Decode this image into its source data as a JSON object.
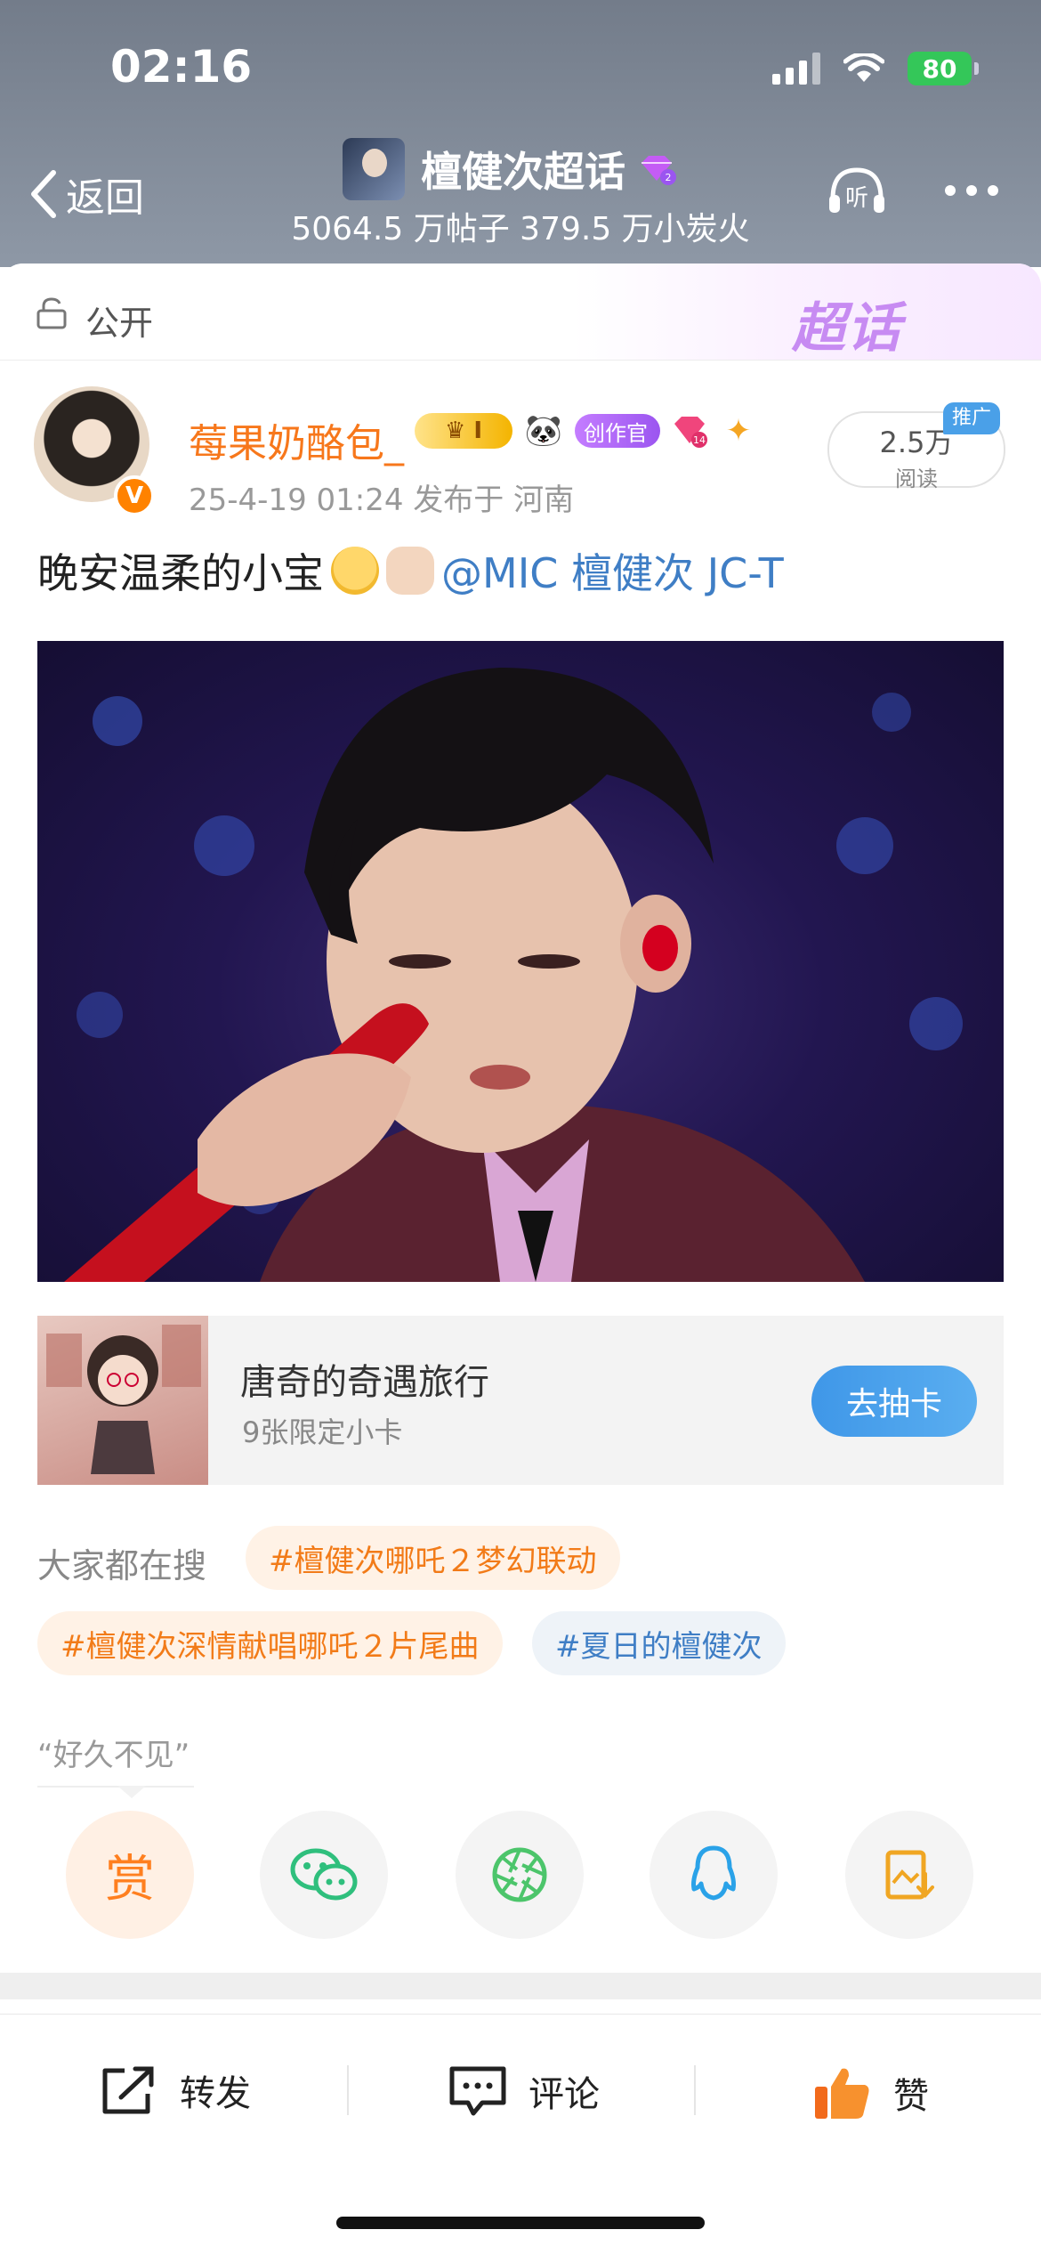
{
  "status_bar": {
    "time": "02:16",
    "battery": "80"
  },
  "header": {
    "back_label": "返回",
    "topic_title": "檀健次超话",
    "topic_stats": "5064.5 万帖子  379.5 万小炭火",
    "listen_icon_text": "听"
  },
  "visibility": {
    "label": "公开",
    "logo_text": "超话"
  },
  "post": {
    "username": "莓果奶酪包_",
    "crown_level": "I",
    "creator_badge": "创作官",
    "gem_level": "14",
    "meta": "25-4-19 01:24  发布于 河南",
    "read_count": "2.5万",
    "read_label": "阅读",
    "promo_tag": "推广",
    "text": "晚安温柔的小宝",
    "mention": "@MIC 檀健次 JC-T"
  },
  "promo_card": {
    "title": "唐奇的奇遇旅行",
    "subtitle": "9张限定小卡",
    "button": "去抽卡"
  },
  "search": {
    "label": "大家都在搜",
    "tags": [
      "#檀健次哪吒２梦幻联动",
      "#檀健次深情献唱哪吒２片尾曲",
      "#夏日的檀健次"
    ]
  },
  "quote": "“好久不见”",
  "share": {
    "reward_label": "赏"
  },
  "actions": {
    "repost": "转发",
    "comment": "评论",
    "like": "赞"
  },
  "colors": {
    "accent_orange": "#f7771b",
    "link_blue": "#3f7ec5",
    "button_blue": "#4aa0e8"
  }
}
